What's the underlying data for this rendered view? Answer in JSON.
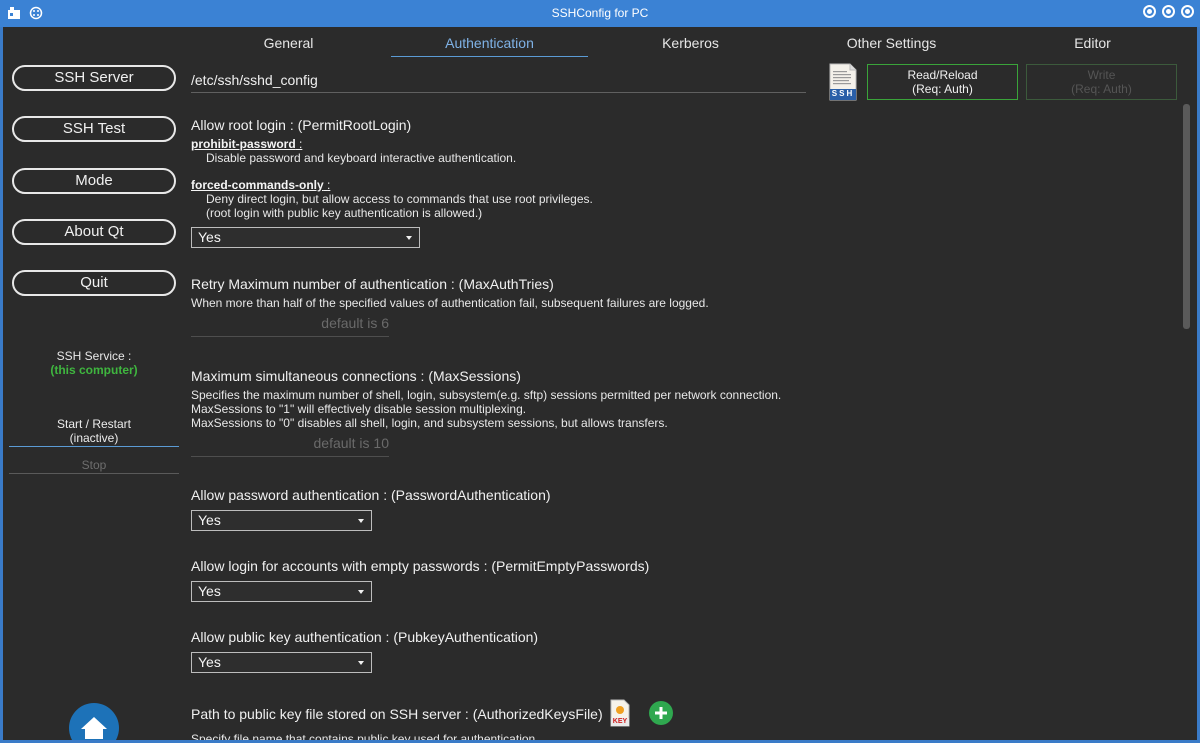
{
  "window": {
    "title": "SSHConfig for PC"
  },
  "tabs": [
    {
      "label": "General"
    },
    {
      "label": "Authentication"
    },
    {
      "label": "Kerberos"
    },
    {
      "label": "Other Settings"
    },
    {
      "label": "Editor"
    }
  ],
  "sidebar": {
    "ssh_server": "SSH Server",
    "ssh_test": "SSH Test",
    "mode": "Mode",
    "about_qt": "About Qt",
    "quit": "Quit",
    "service_label": "SSH Service :",
    "service_target": "(this computer)",
    "start_restart": "Start / Restart",
    "start_state": "(inactive)",
    "stop": "Stop"
  },
  "toolbar": {
    "config_path": "/etc/ssh/sshd_config",
    "ssh_icon_text": "SSH",
    "read_reload_line1": "Read/Reload",
    "read_reload_line2": "(Req: Auth)",
    "write_line1": "Write",
    "write_line2": "(Req: Auth)"
  },
  "settings": {
    "permit_root": {
      "title": "Allow root login : (PermitRootLogin)",
      "opt1_name": "prohibit-password",
      "opt1_desc": "Disable password and keyboard interactive authentication.",
      "opt2_name": "forced-commands-only",
      "opt2_desc1": "Deny direct login, but allow access to commands that use root privileges.",
      "opt2_desc2": "(root login with public key authentication is allowed.)",
      "value": "Yes"
    },
    "max_auth_tries": {
      "title": "Retry Maximum number of authentication : (MaxAuthTries)",
      "desc": "When more than half of the specified values of authentication fail, subsequent failures are logged.",
      "placeholder": "default is 6"
    },
    "max_sessions": {
      "title": "Maximum simultaneous connections : (MaxSessions)",
      "desc1": "Specifies the maximum number of shell, login, subsystem(e.g. sftp) sessions permitted per network connection.",
      "desc2": "MaxSessions to \"1\" will effectively disable session multiplexing.",
      "desc3": "MaxSessions to \"0\" disables all shell, login, and subsystem sessions, but allows transfers.",
      "placeholder": "default is 10"
    },
    "password_auth": {
      "title": "Allow password authentication : (PasswordAuthentication)",
      "value": "Yes"
    },
    "empty_passwords": {
      "title": "Allow login for accounts with empty passwords : (PermitEmptyPasswords)",
      "value": "Yes"
    },
    "pubkey_auth": {
      "title": "Allow public key authentication : (PubkeyAuthentication)",
      "value": "Yes"
    },
    "authorized_keys": {
      "title": "Path to public key file stored on SSH server : (AuthorizedKeysFile)",
      "key_icon_text": "KEY",
      "desc": "Specify file name that contains public key used for authentication."
    }
  }
}
